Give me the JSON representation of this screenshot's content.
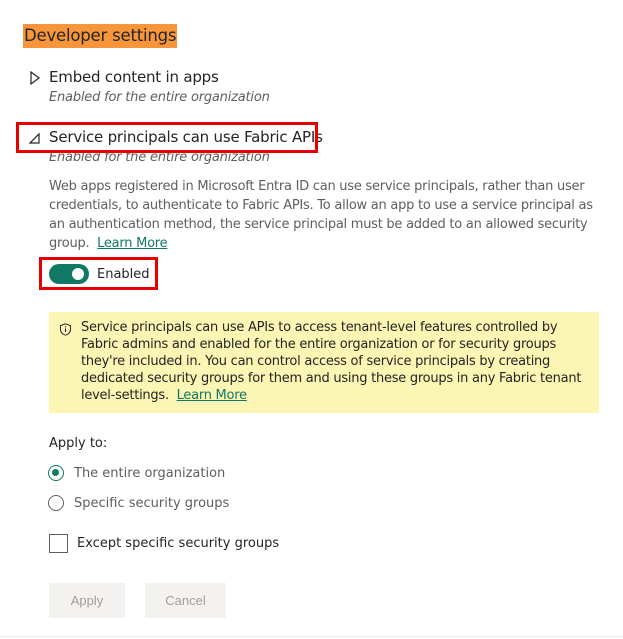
{
  "section": {
    "title": "Developer settings"
  },
  "settings": [
    {
      "name": "Embed content in apps",
      "scope": "Enabled for the entire organization",
      "state": "collapsed"
    },
    {
      "name": "Service principals can use Fabric APIs",
      "scope": "Enabled for the entire organization",
      "state": "expanded"
    }
  ],
  "detail": {
    "description": "Web apps registered in Microsoft Entra ID can use service principals, rather than user credentials, to authenticate to Fabric APIs. To allow an app to use a service principal as an authentication method, the service principal must be added to an allowed security group.",
    "learn_more": "Learn More",
    "toggle": {
      "label": "Enabled",
      "on": true
    },
    "notice": {
      "icon": "shield-info-icon",
      "text": "Service principals can use APIs to access tenant-level features controlled by Fabric admins and enabled for the entire organization or for security groups they're included in. You can control access of service principals by creating dedicated security groups for them and using these groups in any Fabric tenant level-settings.",
      "learn_more": "Learn More"
    },
    "apply_to": {
      "label": "Apply to:",
      "options": [
        {
          "label": "The entire organization",
          "selected": true
        },
        {
          "label": "Specific security groups",
          "selected": false
        }
      ]
    },
    "except_checkbox": {
      "label": "Except specific security groups",
      "checked": false
    },
    "buttons": {
      "apply": "Apply",
      "cancel": "Cancel"
    }
  },
  "colors": {
    "accent": "#117865",
    "section_highlight": "#f7953a",
    "annotation_box": "#e60000",
    "notice_bg": "#fbf6b3"
  }
}
